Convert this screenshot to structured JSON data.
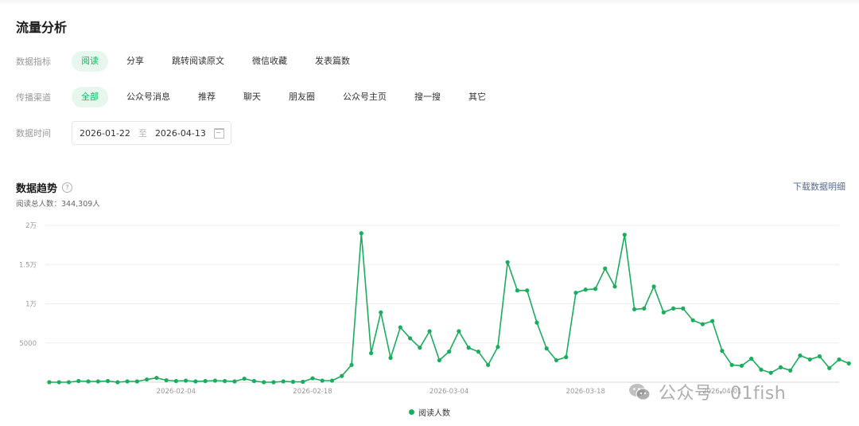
{
  "page": {
    "title": "流量分析"
  },
  "filters": {
    "metric": {
      "label": "数据指标",
      "options": [
        "阅读",
        "分享",
        "跳转阅读原文",
        "微信收藏",
        "发表篇数"
      ],
      "active": 0
    },
    "channel": {
      "label": "传播渠道",
      "options": [
        "全部",
        "公众号消息",
        "推荐",
        "聊天",
        "朋友圈",
        "公众号主页",
        "搜一搜",
        "其它"
      ],
      "active": 0
    },
    "time": {
      "label": "数据时间",
      "start": "2026-01-22",
      "separator": "至",
      "end": "2026-04-13"
    }
  },
  "trend": {
    "title": "数据趋势",
    "help": "?",
    "download": "下载数据明细",
    "total_label": "阅读总人数：",
    "total_value": "344,309人"
  },
  "watermark": {
    "text": "公众号 · 01fish",
    "icon": "wechat-icon"
  },
  "chart_data": {
    "type": "line",
    "color": "#1aad5c",
    "grid": true,
    "legend": "bottom-center",
    "ylim": [
      0,
      20000
    ],
    "yticks": [
      {
        "value": 0,
        "label": ""
      },
      {
        "value": 5000,
        "label": "5000"
      },
      {
        "value": 10000,
        "label": "1万"
      },
      {
        "value": 15000,
        "label": "1.5万"
      },
      {
        "value": 20000,
        "label": "2万"
      }
    ],
    "x_start": "2026-01-22",
    "x_end": "2026-04-13",
    "xticks": [
      "2026-02-04",
      "2026-02-18",
      "2026-03-04",
      "2026-03-18",
      "2026-04-01"
    ],
    "series": [
      {
        "name": "阅读人数",
        "values": [
          0,
          0,
          0,
          150,
          100,
          100,
          150,
          0,
          100,
          100,
          350,
          550,
          250,
          150,
          200,
          100,
          150,
          200,
          150,
          100,
          450,
          150,
          0,
          0,
          100,
          50,
          50,
          500,
          200,
          200,
          800,
          2200,
          19000,
          3700,
          8900,
          3100,
          7000,
          5600,
          4400,
          6500,
          2800,
          3900,
          6500,
          4400,
          3900,
          2200,
          4500,
          15300,
          11700,
          11700,
          7600,
          4300,
          2800,
          3200,
          11400,
          11800,
          11900,
          14500,
          12200,
          18800,
          9300,
          9400,
          12200,
          8900,
          9400,
          9400,
          7900,
          7400,
          7800,
          4000,
          2200,
          2100,
          3000,
          1600,
          1200,
          1900,
          1500,
          3400,
          2900,
          3300,
          1800,
          2900,
          2400
        ]
      }
    ]
  }
}
